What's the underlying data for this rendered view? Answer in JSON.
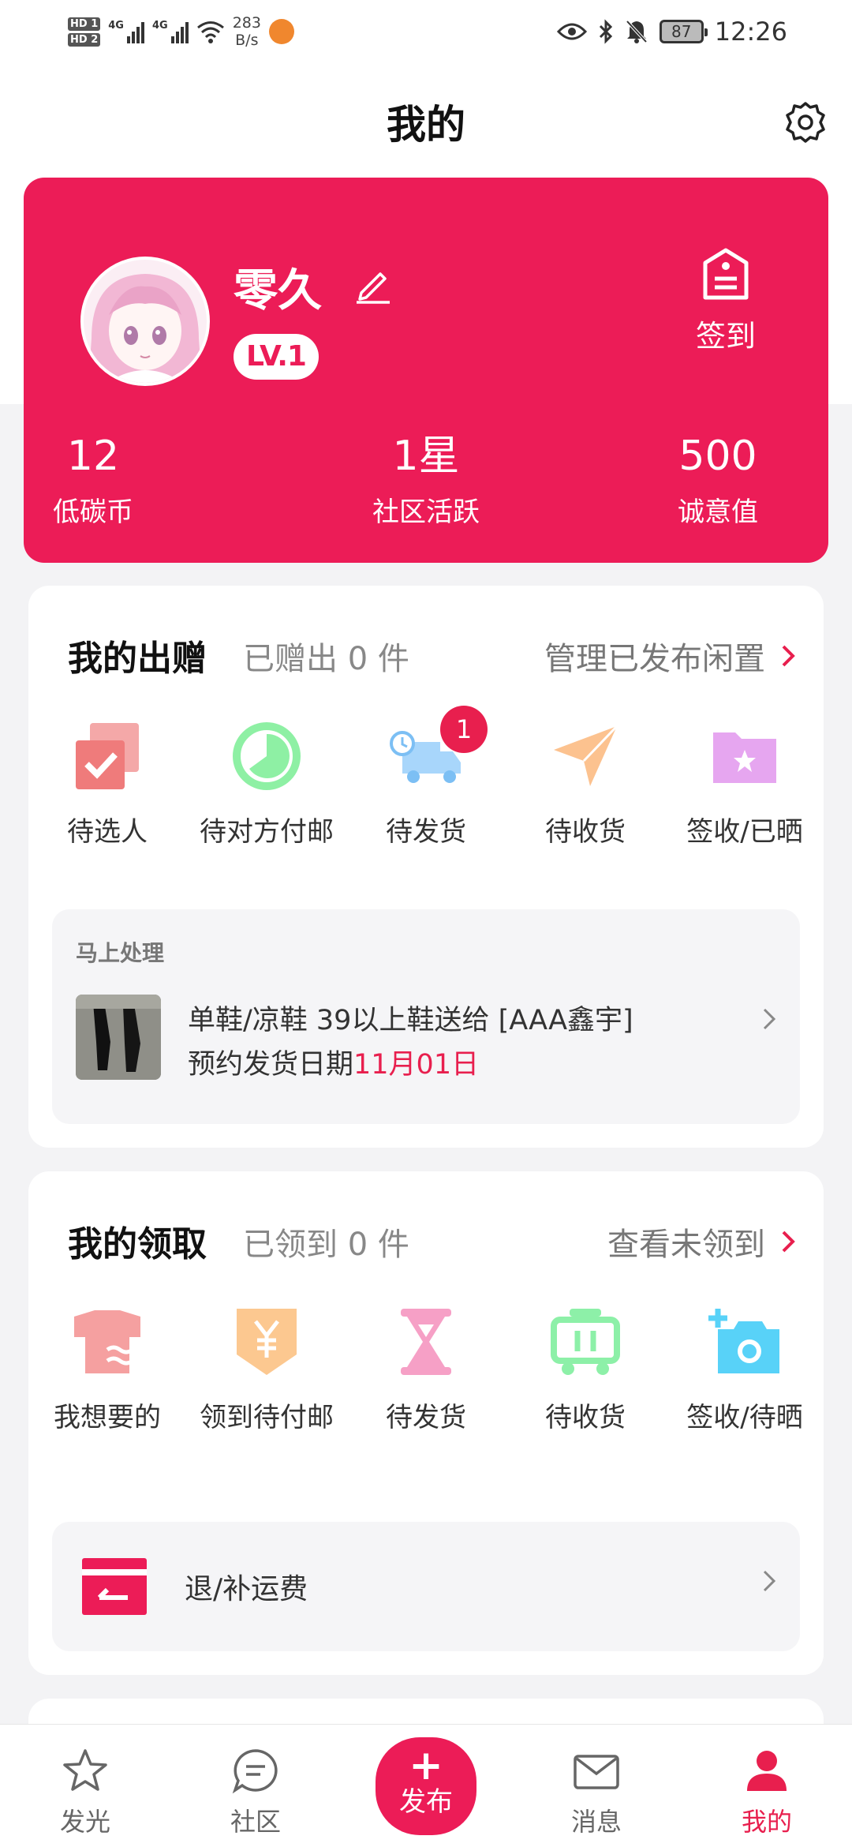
{
  "status_bar": {
    "hd1": "HD 1",
    "hd2": "HD 2",
    "net1": "4G",
    "net2": "4G",
    "speed_value": "283",
    "speed_unit": "B/s",
    "battery": "87",
    "time": "12:26"
  },
  "header": {
    "title": "我的"
  },
  "profile": {
    "name": "零久",
    "level": "LV.1",
    "checkin_label": "签到",
    "stats": [
      {
        "value": "12",
        "label": "低碳币"
      },
      {
        "value": "1星",
        "label": "社区活跃"
      },
      {
        "value": "500",
        "label": "诚意值"
      }
    ]
  },
  "giving": {
    "title": "我的出赠",
    "summary": "已赠出 0 件",
    "link": "管理已发布闲置",
    "items": [
      {
        "label": "待选人",
        "icon": "checked-square-icon"
      },
      {
        "label": "待对方付邮",
        "icon": "clock-circle-icon"
      },
      {
        "label": "待发货",
        "icon": "delivery-truck-icon",
        "badge": "1"
      },
      {
        "label": "待收货",
        "icon": "paper-plane-icon"
      },
      {
        "label": "签收/已晒",
        "icon": "star-folder-icon"
      }
    ],
    "pending": {
      "heading": "马上处理",
      "title": "单鞋/凉鞋 39以上鞋送给 [AAA鑫宇]",
      "date_prefix": "预约发货日期",
      "date": "11月01日"
    }
  },
  "receiving": {
    "title": "我的领取",
    "summary": "已领到 0 件",
    "link": "查看未领到",
    "items": [
      {
        "label": "我想要的",
        "icon": "shirt-icon"
      },
      {
        "label": "领到待付邮",
        "icon": "yen-tag-icon"
      },
      {
        "label": "待发货",
        "icon": "hourglass-icon"
      },
      {
        "label": "待收货",
        "icon": "cart-icon"
      },
      {
        "label": "签收/待晒",
        "icon": "camera-plus-icon"
      }
    ],
    "refund_label": "退/补运费"
  },
  "bottom_nav": {
    "items": [
      {
        "label": "发光",
        "icon": "star-icon"
      },
      {
        "label": "社区",
        "icon": "chat-bubble-icon"
      },
      {
        "label": "发布",
        "icon": "plus-icon"
      },
      {
        "label": "消息",
        "icon": "envelope-icon"
      },
      {
        "label": "我的",
        "icon": "person-icon",
        "active": true
      }
    ]
  },
  "colors": {
    "accent": "#ec1c57",
    "badge": "#e81f4e",
    "background": "#f3f3f5"
  }
}
